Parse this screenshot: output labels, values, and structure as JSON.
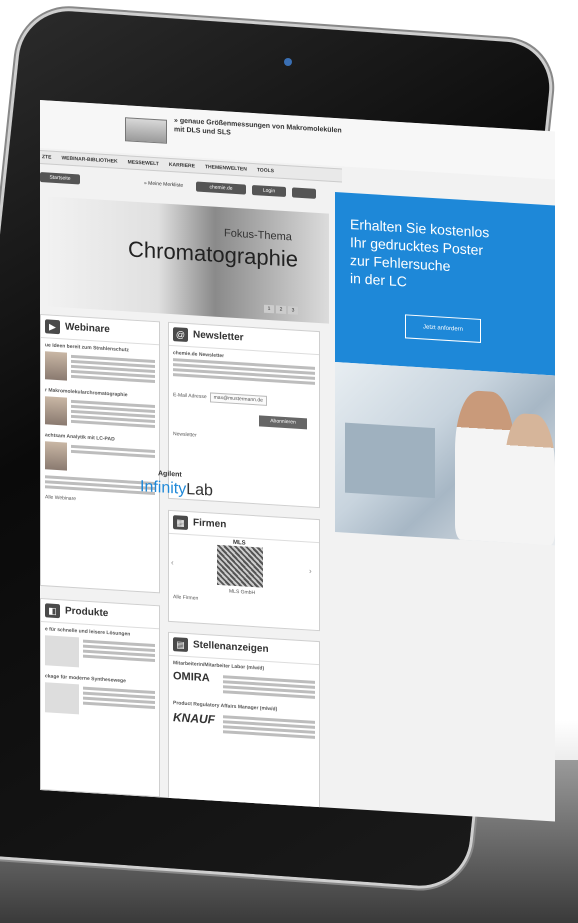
{
  "banner": {
    "text": "» genaue Größenmessungen von Makromolekülen mit DLS und SLS"
  },
  "nav": {
    "items": [
      "ZTE",
      "WEBINAR-BIBLIOTHEK",
      "MESSEWELT",
      "KARRIERE",
      "THEMENWELTEN",
      "TOOLS"
    ]
  },
  "toolbar": {
    "start_label": "Startseite",
    "watchlist_label": "» Meine Merkliste",
    "domain_label": "chemie.de",
    "login_label": "Login"
  },
  "hero": {
    "subtitle": "Fokus-Thema",
    "title": "Chromatographie",
    "pages": [
      "1",
      "2",
      "3"
    ]
  },
  "webinare": {
    "title": "Webinare",
    "entry1_title": "ue Ideen bereit zum Strahlenschutz",
    "entry2_title": "r Makromolekularchromatographie",
    "entry3_title": "achtsam Analytik mit LC-PAD",
    "more": "Alle Webinare"
  },
  "newsletter": {
    "title": "Newsletter",
    "subtitle": "chemie.de Newsletter",
    "email_label": "E-Mail Adresse",
    "email_value": "max@mustermann.de",
    "subscribe": "Abonnieren",
    "footer": "Newsletter"
  },
  "firmen": {
    "title": "Firmen",
    "logo_label": "MLS",
    "company_name": "MLS GmbH",
    "more": "Alle Firmen"
  },
  "produkte": {
    "title": "Produkte",
    "entry1_title": "e für schnelle und leisere Lösungen",
    "entry2_title": "ckage für moderne Synthesewege"
  },
  "stellen": {
    "title": "Stellenanzeigen",
    "job1": "Mitarbeiterin/Mitarbeiter Labor (m/w/d)",
    "logo1": "OMIRA",
    "job2": "Product Regulatory Affairs Manager (m/w/d)",
    "logo2": "KNAUF"
  },
  "ad": {
    "headline": "Erhalten Sie kostenlos\nIhr gedrucktes Poster\nzur Fehlersuche\nin der LC",
    "button": "Jetzt anfordern",
    "brand_top": "Agilent",
    "brand_a": "Infinity",
    "brand_b": "Lab"
  }
}
